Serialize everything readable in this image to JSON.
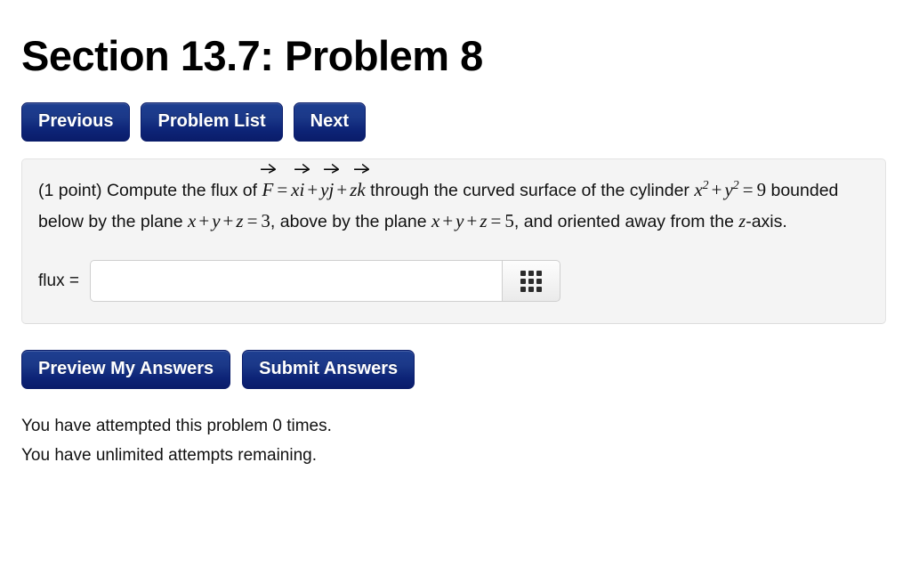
{
  "page": {
    "title": "Section 13.7: Problem 8"
  },
  "nav": {
    "previous_label": "Previous",
    "problem_list_label": "Problem List",
    "next_label": "Next"
  },
  "problem": {
    "points_label": "(1 point)",
    "text_part_1": "Compute the flux of",
    "vector_field": {
      "F": "F",
      "equals": "=",
      "term1_coef": "x",
      "term1_unit": "i",
      "plus1": "+",
      "term2_coef": "y",
      "term2_unit": "j",
      "plus2": "+",
      "term3_coef": "z",
      "term3_unit": "k"
    },
    "text_part_2": "through the curved surface of the cylinder",
    "cylinder_eq": {
      "x": "x",
      "x_exp": "2",
      "plus": "+",
      "y": "y",
      "y_exp": "2",
      "equals": "=",
      "value": "9"
    },
    "text_part_3": "bounded below by the plane",
    "plane_lower": {
      "x": "x",
      "plus1": "+",
      "y": "y",
      "plus2": "+",
      "z": "z",
      "equals": "=",
      "value": "3"
    },
    "text_part_4": ", above by the plane",
    "plane_upper": {
      "x": "x",
      "plus1": "+",
      "y": "y",
      "plus2": "+",
      "z": "z",
      "equals": "=",
      "value": "5"
    },
    "text_part_5": ", and oriented away from the",
    "axis_var": "z",
    "text_part_6": "-axis."
  },
  "answer": {
    "label": "flux =",
    "value": "",
    "placeholder": "",
    "keypad_icon": "grid-keypad-icon"
  },
  "actions": {
    "preview_label": "Preview My Answers",
    "submit_label": "Submit Answers"
  },
  "status": {
    "attempts_line": "You have attempted this problem 0 times.",
    "remaining_line": "You have unlimited attempts remaining.",
    "attempt_count": "0"
  },
  "colors": {
    "button_blue_top": "#1e3f91",
    "button_blue_bottom": "#0a1c6a",
    "panel_background": "#f4f4f4",
    "panel_border": "#e3e3e3",
    "text": "#000000"
  }
}
